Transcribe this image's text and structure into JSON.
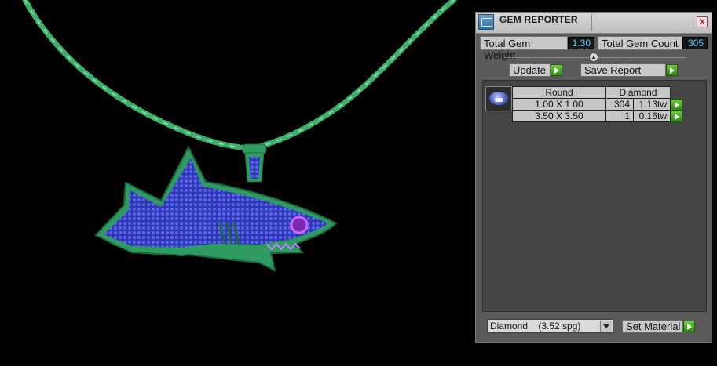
{
  "window": {
    "title": "GEM REPORTER",
    "close_glyph": "✕"
  },
  "summary": {
    "weight_label": "Total Gem Weight",
    "weight_value": "1.30",
    "count_label": "Total Gem Count",
    "count_value": "305"
  },
  "actions": {
    "update_label": "Update",
    "save_label": "Save Report"
  },
  "report": {
    "header": {
      "cut": "Round",
      "material": "Diamond"
    },
    "rows": [
      {
        "size": "1.00 X 1.00",
        "count": "304",
        "weight": "1.13tw"
      },
      {
        "size": "3.50 X 3.50",
        "count": "1",
        "weight": "0.16tw"
      }
    ]
  },
  "material": {
    "selected": "Diamond    (3.52 spg)",
    "set_label": "Set Material"
  },
  "colors": {
    "chain": "#3fae6a",
    "body": "#2f9a62",
    "pave": "#3f46c8",
    "value_text": "#4fc7ff"
  },
  "icons": [
    "app-icon",
    "close-icon",
    "chevron-up-icon",
    "play-arrow-icon",
    "gem-icon",
    "dropdown-arrow-icon"
  ]
}
